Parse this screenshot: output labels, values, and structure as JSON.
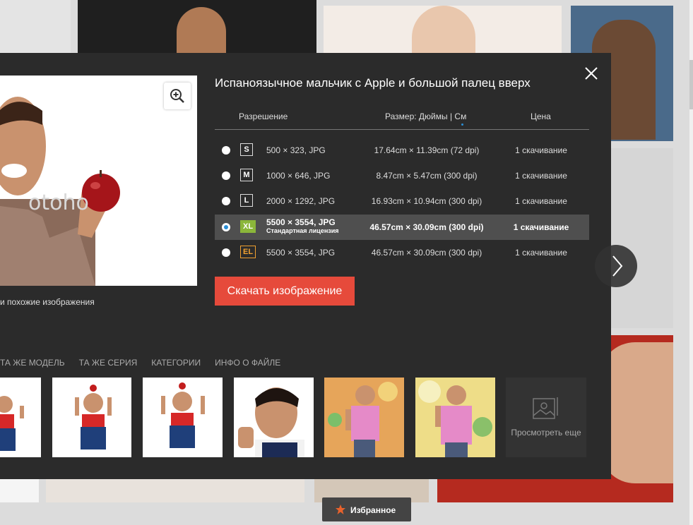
{
  "modal": {
    "title": "Испаноязычное мальчик с Apple и большой палец вверх",
    "watermark": "otoho",
    "similar_link": "и похожие изображения",
    "table_headers": {
      "resolution": "Разрешение",
      "size": "Размер: Дюймы | См",
      "price": "Цена"
    },
    "rows": [
      {
        "badge": "S",
        "resolution": "500 × 323, JPG",
        "size": "17.64cm × 11.39cm (72 dpi)",
        "price": "1 скачивание"
      },
      {
        "badge": "M",
        "resolution": "1000 × 646, JPG",
        "size": "8.47cm × 5.47cm (300 dpi)",
        "price": "1 скачивание"
      },
      {
        "badge": "L",
        "resolution": "2000 × 1292, JPG",
        "size": "16.93cm × 10.94cm (300 dpi)",
        "price": "1 скачивание"
      },
      {
        "badge": "XL",
        "resolution": "5500 × 3554, JPG",
        "license": "Стандартная лицензия",
        "size": "46.57cm × 30.09cm (300 dpi)",
        "price": "1 скачивание"
      },
      {
        "badge": "EL",
        "resolution": "5500 × 3554, JPG",
        "size": "46.57cm × 30.09cm (300 dpi)",
        "price": "1 скачивание"
      }
    ],
    "selected_row": "XL",
    "download_button": "Скачать изображение",
    "tabs": [
      "ТА ЖЕ МОДЕЛЬ",
      "ТА ЖЕ СЕРИЯ",
      "КАТЕГОРИИ",
      "ИНФО О ФАЙЛЕ"
    ],
    "view_more": "Просмотреть еще"
  },
  "favorites_label": "Избранное",
  "colors": {
    "modal_bg": "#2b2b2b",
    "download_button": "#e64a3b",
    "xl_badge": "#8bb63a",
    "el_badge": "#f0a030",
    "radio_selected": "#2b8fd6"
  },
  "icons": [
    "zoom-in-icon",
    "close-icon",
    "chevron-right-icon",
    "image-placeholder-icon",
    "star-icon"
  ]
}
